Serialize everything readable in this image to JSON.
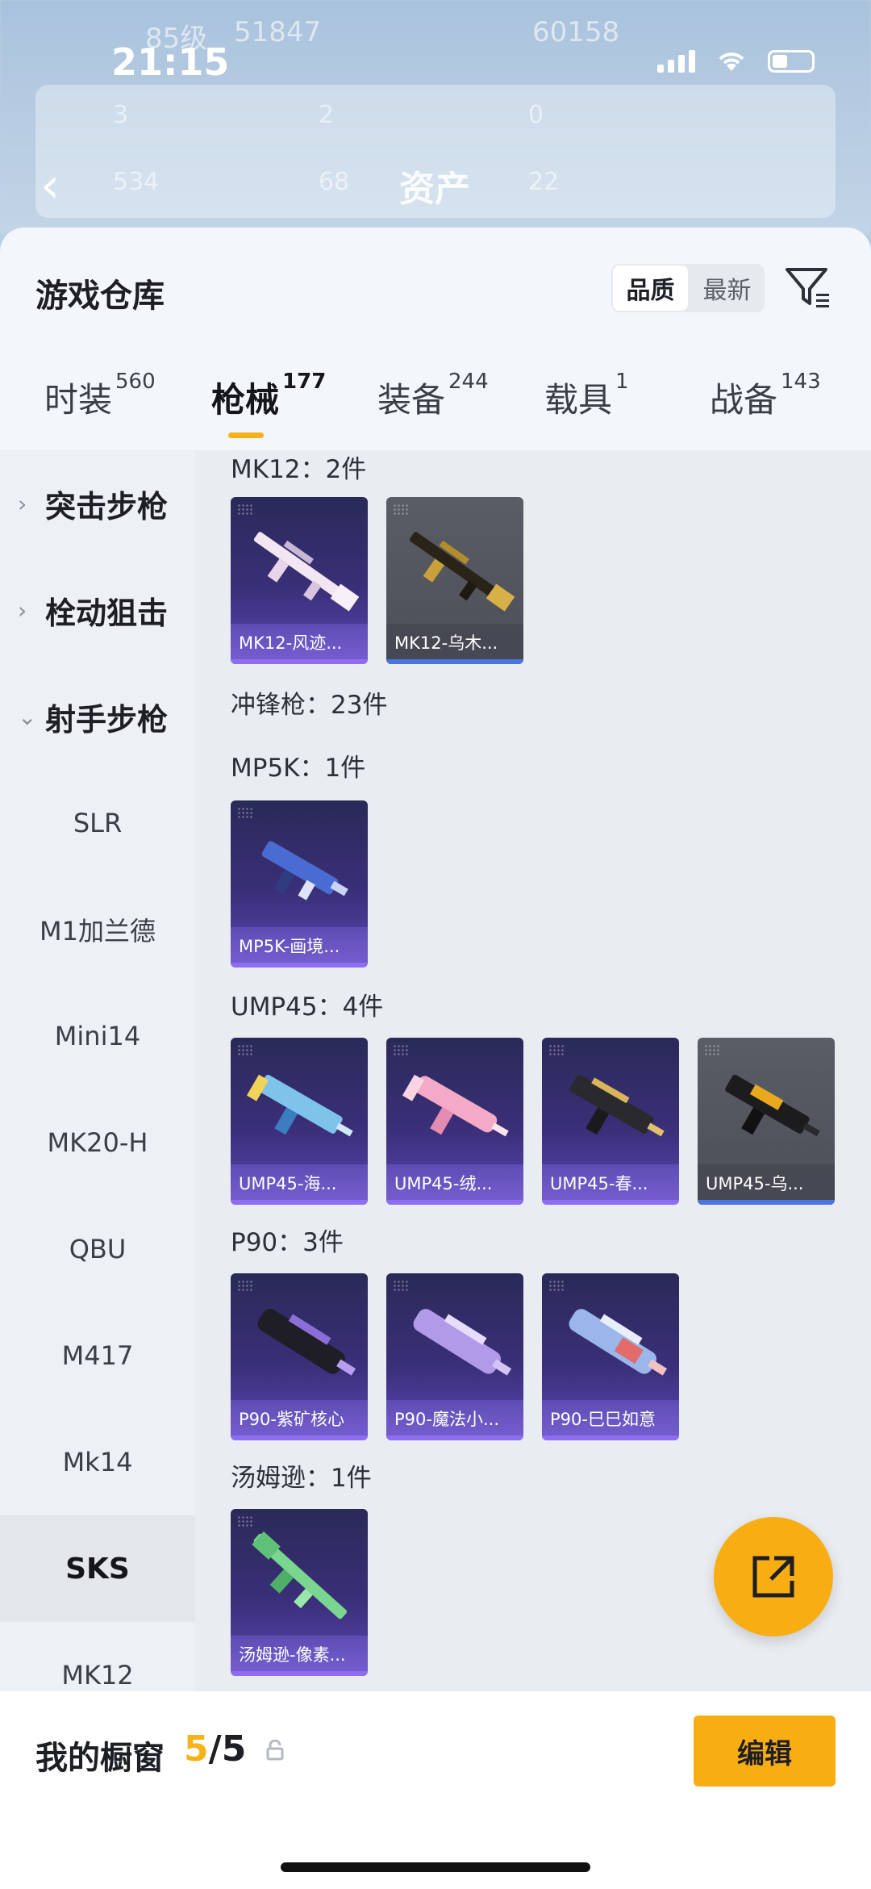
{
  "status_bar": {
    "time": "21:15"
  },
  "background": {
    "level": "85级",
    "coin_a": "51847",
    "coin_b": "60158",
    "title": "资产",
    "stats": [
      "3",
      "2",
      "0",
      "534",
      "68",
      "22"
    ]
  },
  "sheet": {
    "title": "游戏仓库",
    "sort_options": [
      "品质",
      "最新"
    ],
    "active_sort": "品质",
    "tabs": [
      {
        "label": "时装",
        "count": "560"
      },
      {
        "label": "枪械",
        "count": "177"
      },
      {
        "label": "装备",
        "count": "244"
      },
      {
        "label": "载具",
        "count": "1"
      },
      {
        "label": "战备",
        "count": "143"
      }
    ],
    "active_tab": "枪械"
  },
  "categories": [
    {
      "label": "突击步枪",
      "type": "group",
      "expanded": false
    },
    {
      "label": "栓动狙击",
      "type": "group",
      "expanded": false
    },
    {
      "label": "射手步枪",
      "type": "group",
      "expanded": true
    },
    {
      "label": "SLR",
      "type": "item"
    },
    {
      "label": "M1加兰德",
      "type": "item"
    },
    {
      "label": "Mini14",
      "type": "item"
    },
    {
      "label": "MK20-H",
      "type": "item"
    },
    {
      "label": "QBU",
      "type": "item"
    },
    {
      "label": "M417",
      "type": "item"
    },
    {
      "label": "Mk14",
      "type": "item"
    },
    {
      "label": "SKS",
      "type": "item",
      "selected": true
    },
    {
      "label": "MK12",
      "type": "item"
    }
  ],
  "content": {
    "mk12_label": "MK12：2件",
    "mk12_items": [
      "MK12-风迹...",
      "MK12-乌木..."
    ],
    "smg_label": "冲锋枪：23件",
    "mp5k_label": "MP5K：1件",
    "mp5k_items": [
      "MP5K-画境..."
    ],
    "ump_label": "UMP45：4件",
    "ump_items": [
      "UMP45-海...",
      "UMP45-绒...",
      "UMP45-春...",
      "UMP45-乌..."
    ],
    "p90_label": "P90：3件",
    "p90_items": [
      "P90-紫矿核心",
      "P90-魔法小...",
      "P90-巳巳如意"
    ],
    "tommy_label": "汤姆逊：1件",
    "tommy_items": [
      "汤姆逊-像素..."
    ]
  },
  "bottom_bar": {
    "title": "我的橱窗",
    "current": "5",
    "total": "/5",
    "edit_label": "编辑"
  },
  "colors": {
    "accent": "#f8ad12",
    "card_purple": "#5b47b6",
    "card_gray": "#4c4e58"
  }
}
